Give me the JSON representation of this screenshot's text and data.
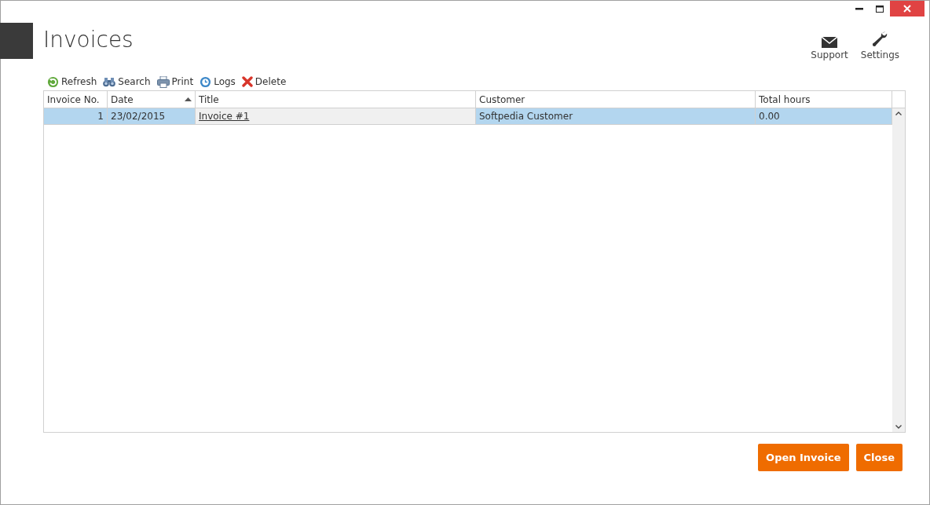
{
  "window": {
    "title": "Invoices"
  },
  "header_actions": [
    {
      "label": "Support",
      "kind": "mail"
    },
    {
      "label": "Settings",
      "kind": "wrench"
    }
  ],
  "toolbar": [
    {
      "label": "Refresh",
      "kind": "refresh"
    },
    {
      "label": "Search",
      "kind": "binoculars"
    },
    {
      "label": "Print",
      "kind": "printer"
    },
    {
      "label": "Logs",
      "kind": "logs"
    },
    {
      "label": "Delete",
      "kind": "delete"
    }
  ],
  "table": {
    "columns": [
      {
        "label": "Invoice No.",
        "sorted": false
      },
      {
        "label": "Date",
        "sorted": true
      },
      {
        "label": "Title",
        "sorted": false
      },
      {
        "label": "Customer",
        "sorted": false
      },
      {
        "label": "Total hours",
        "sorted": false
      }
    ],
    "rows": [
      {
        "selected": true,
        "cells": [
          {
            "text": "1",
            "kind": "number",
            "current": false
          },
          {
            "text": "23/02/2015",
            "kind": "text",
            "current": false
          },
          {
            "text": "Invoice #1",
            "kind": "link",
            "current": true
          },
          {
            "text": "Softpedia Customer",
            "kind": "text",
            "current": false
          },
          {
            "text": "0.00",
            "kind": "text",
            "current": false
          }
        ]
      }
    ]
  },
  "buttons": [
    {
      "label": "Open Invoice"
    },
    {
      "label": "Close"
    }
  ]
}
